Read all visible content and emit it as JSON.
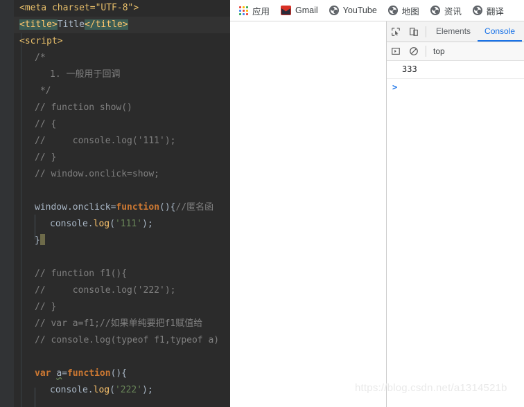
{
  "editor": {
    "name": "webstorm-code-editor",
    "background": "#2b2b2b",
    "lines": [
      {
        "indent": 0,
        "segments": [
          {
            "t": "<meta charset=\"UTF-8\">",
            "c": "tag"
          }
        ]
      },
      {
        "indent": 0,
        "current": true,
        "segments": [
          {
            "t": "<title>",
            "c": "tagsel"
          },
          {
            "t": "Title",
            "c": "txt"
          },
          {
            "t": "</title>",
            "c": "tagsel"
          }
        ]
      },
      {
        "indent": 0,
        "segments": [
          {
            "t": "<script>",
            "c": "tag"
          }
        ]
      },
      {
        "indent": 1,
        "segments": [
          {
            "t": "/*",
            "c": "cm"
          }
        ]
      },
      {
        "indent": 2,
        "segments": [
          {
            "t": "1. 一般用于回调",
            "c": "cm"
          }
        ]
      },
      {
        "indent": 1,
        "segments": [
          {
            "t": " */",
            "c": "cm"
          }
        ]
      },
      {
        "indent": 1,
        "segments": [
          {
            "t": "// function show()",
            "c": "cm"
          }
        ]
      },
      {
        "indent": 1,
        "segments": [
          {
            "t": "// {",
            "c": "cm"
          }
        ]
      },
      {
        "indent": 1,
        "segments": [
          {
            "t": "//     console.log('111');",
            "c": "cm"
          }
        ]
      },
      {
        "indent": 1,
        "segments": [
          {
            "t": "// }",
            "c": "cm"
          }
        ]
      },
      {
        "indent": 1,
        "segments": [
          {
            "t": "// window.onclick=show;",
            "c": "cm"
          }
        ]
      },
      {
        "indent": 0,
        "segments": []
      },
      {
        "indent": 1,
        "segments": [
          {
            "t": "window.onclick=",
            "c": "ident"
          },
          {
            "t": "function",
            "c": "kw"
          },
          {
            "t": "(){",
            "c": "ident"
          },
          {
            "t": "//匿名函",
            "c": "cm"
          }
        ]
      },
      {
        "indent": 2,
        "segments": [
          {
            "t": "console.",
            "c": "ident"
          },
          {
            "t": "log",
            "c": "fn"
          },
          {
            "t": "(",
            "c": "ident"
          },
          {
            "t": "'111'",
            "c": "str"
          },
          {
            "t": ");",
            "c": "ident"
          }
        ]
      },
      {
        "indent": 1,
        "segments": [
          {
            "t": "}",
            "c": "ident"
          },
          {
            "t": "CARET",
            "c": "caret"
          }
        ]
      },
      {
        "indent": 0,
        "segments": []
      },
      {
        "indent": 1,
        "segments": [
          {
            "t": "// function f1(){",
            "c": "cm"
          }
        ]
      },
      {
        "indent": 1,
        "segments": [
          {
            "t": "//     console.log('222');",
            "c": "cm"
          }
        ]
      },
      {
        "indent": 1,
        "segments": [
          {
            "t": "// }",
            "c": "cm"
          }
        ]
      },
      {
        "indent": 1,
        "segments": [
          {
            "t": "// var a=f1;//如果单纯要把f1赋值给",
            "c": "cm"
          }
        ]
      },
      {
        "indent": 1,
        "segments": [
          {
            "t": "// console.log(typeof f1,typeof a)",
            "c": "cm"
          }
        ]
      },
      {
        "indent": 0,
        "segments": []
      },
      {
        "indent": 1,
        "segments": [
          {
            "t": "var ",
            "c": "kw"
          },
          {
            "t": "a",
            "c": "wavy"
          },
          {
            "t": "=",
            "c": "ident"
          },
          {
            "t": "function",
            "c": "kw"
          },
          {
            "t": "(){",
            "c": "ident"
          }
        ]
      },
      {
        "indent": 2,
        "segments": [
          {
            "t": "console.",
            "c": "ident"
          },
          {
            "t": "log",
            "c": "fn"
          },
          {
            "t": "(",
            "c": "ident"
          },
          {
            "t": "'222'",
            "c": "str"
          },
          {
            "t": ");",
            "c": "ident"
          }
        ]
      }
    ]
  },
  "browser": {
    "bookmarks": [
      {
        "label": "应用",
        "icon": "apps-grid-icon"
      },
      {
        "label": "Gmail",
        "icon": "gmail-icon"
      },
      {
        "label": "YouTube",
        "icon": "globe-icon"
      },
      {
        "label": "地图",
        "icon": "globe-icon"
      },
      {
        "label": "资讯",
        "icon": "globe-icon"
      },
      {
        "label": "翻译",
        "icon": "globe-icon"
      }
    ]
  },
  "devtools": {
    "inspect_icon": "inspect-element-icon",
    "device_icon": "device-toolbar-icon",
    "tabs": [
      {
        "label": "Elements",
        "active": false
      },
      {
        "label": "Console",
        "active": true
      }
    ],
    "toolbar": {
      "sidebar_icon": "console-sidebar-icon",
      "clear_icon": "clear-console-icon",
      "context": "top"
    },
    "console": {
      "messages": [
        "333"
      ],
      "prompt": ">"
    }
  },
  "watermark": {
    "text": "https://blog.csdn.net/a1314521b"
  }
}
